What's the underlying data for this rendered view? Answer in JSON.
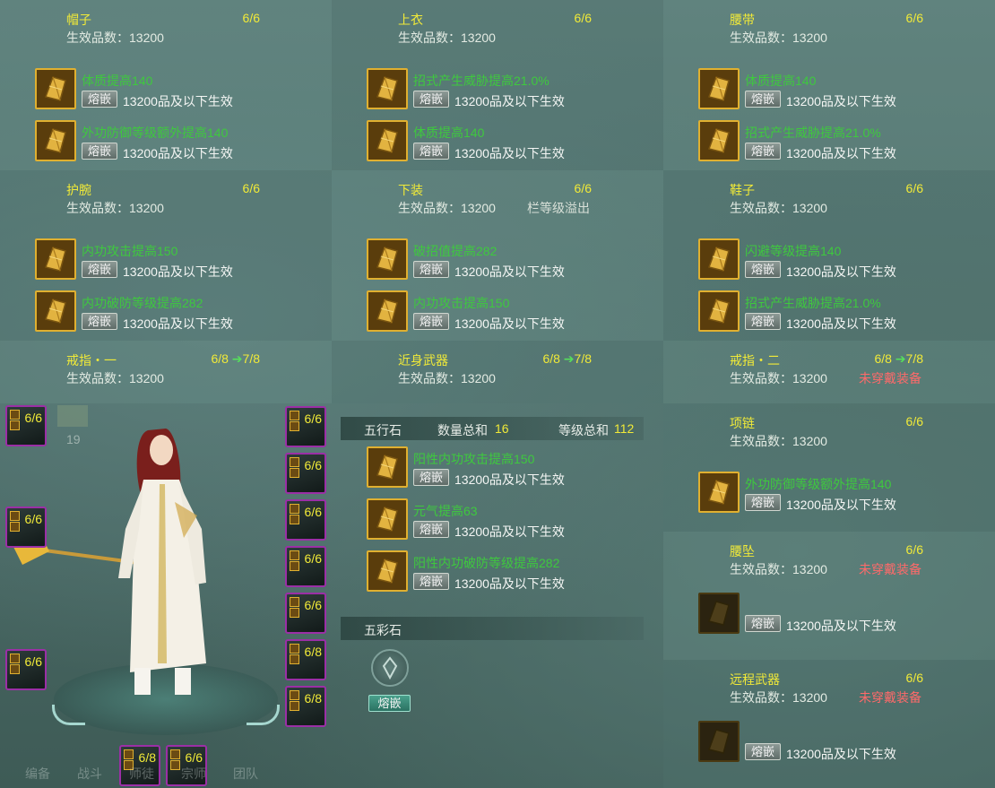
{
  "slots": [
    {
      "name": "帽子",
      "count": "6/6",
      "grade": "生效品数：13200",
      "gems": [
        {
          "label": "体质提高140"
        },
        {
          "label": "外功防御等级额外提高140"
        }
      ]
    },
    {
      "name": "上衣",
      "count": "6/6",
      "grade": "生效品数：13200",
      "gems": [
        {
          "label": "招式产生威胁提高21.0%"
        },
        {
          "label": "体质提高140"
        }
      ]
    },
    {
      "name": "腰带",
      "count": "6/6",
      "grade": "生效品数：13200",
      "gems": [
        {
          "label": "体质提高140"
        },
        {
          "label": "招式产生威胁提高21.0%"
        }
      ]
    },
    {
      "name": "护腕",
      "count": "6/6",
      "grade": "生效品数：13200",
      "gems": [
        {
          "label": "内功攻击提高150"
        },
        {
          "label": "内功破防等级提高282"
        }
      ]
    },
    {
      "name": "下装",
      "count": "6/6",
      "grade": "生效品数：13200",
      "extra": "栏等级溢出",
      "gems": [
        {
          "label": "破招值提高282"
        },
        {
          "label": "内功攻击提高150"
        }
      ]
    },
    {
      "name": "鞋子",
      "count": "6/6",
      "grade": "生效品数：13200",
      "gems": [
        {
          "label": "闪避等级提高140"
        },
        {
          "label": "招式产生威胁提高21.0%"
        }
      ]
    },
    {
      "name": "戒指・一",
      "count": "6/8",
      "upgrade": "7/8",
      "grade": "生效品数：13200"
    },
    {
      "name": "近身武器",
      "count": "6/8",
      "upgrade": "7/8",
      "grade": "生效品数：13200"
    },
    {
      "name": "戒指・二",
      "count": "6/8",
      "upgrade": "7/8",
      "grade": "生效品数：13200",
      "extra": "未穿戴装备"
    },
    {
      "name": "项链",
      "count": "6/6",
      "grade": "生效品数：13200",
      "gems": [
        {
          "label": "外功防御等级额外提高140"
        }
      ]
    },
    {
      "name": "腰坠",
      "count": "6/6",
      "grade": "生效品数：13200",
      "extra": "未穿戴装备",
      "gems": [
        {
          "label": ""
        }
      ]
    },
    {
      "name": "远程武器",
      "count": "6/6",
      "grade": "生效品数：13200",
      "extra": "未穿戴装备",
      "gems": [
        {
          "label": ""
        }
      ]
    }
  ],
  "inlay_label": "熔嵌",
  "effect_text": "13200品及以下生效",
  "wuxing": {
    "title": "五行石",
    "qty_label": "数量总和",
    "qty": "16",
    "lvl_label": "等级总和",
    "lvl": "112",
    "gems": [
      {
        "label": "阳性内功攻击提高150"
      },
      {
        "label": "元气提高63"
      },
      {
        "label": "阳性内功破防等级提高282"
      }
    ]
  },
  "wucai": {
    "title": "五彩石",
    "button": "熔嵌"
  },
  "equip_left": [
    "6/6",
    "6/6",
    "6/6"
  ],
  "equip_right": [
    "6/6",
    "6/6",
    "6/6",
    "6/6",
    "6/6",
    "6/8",
    "6/8"
  ],
  "equip_bottom": [
    "6/8",
    "6/6"
  ],
  "misc_number": "19",
  "bottom_tabs": [
    "编备",
    "战斗",
    "师徒",
    "宗师",
    "团队"
  ],
  "arrow_symbol": "➔",
  "colors": {
    "title": "#f1ea38",
    "gem_text": "#3ec93e",
    "warn": "#ff6a6a",
    "arrow": "#56e05b",
    "slot_border": "#9b2fa6"
  }
}
